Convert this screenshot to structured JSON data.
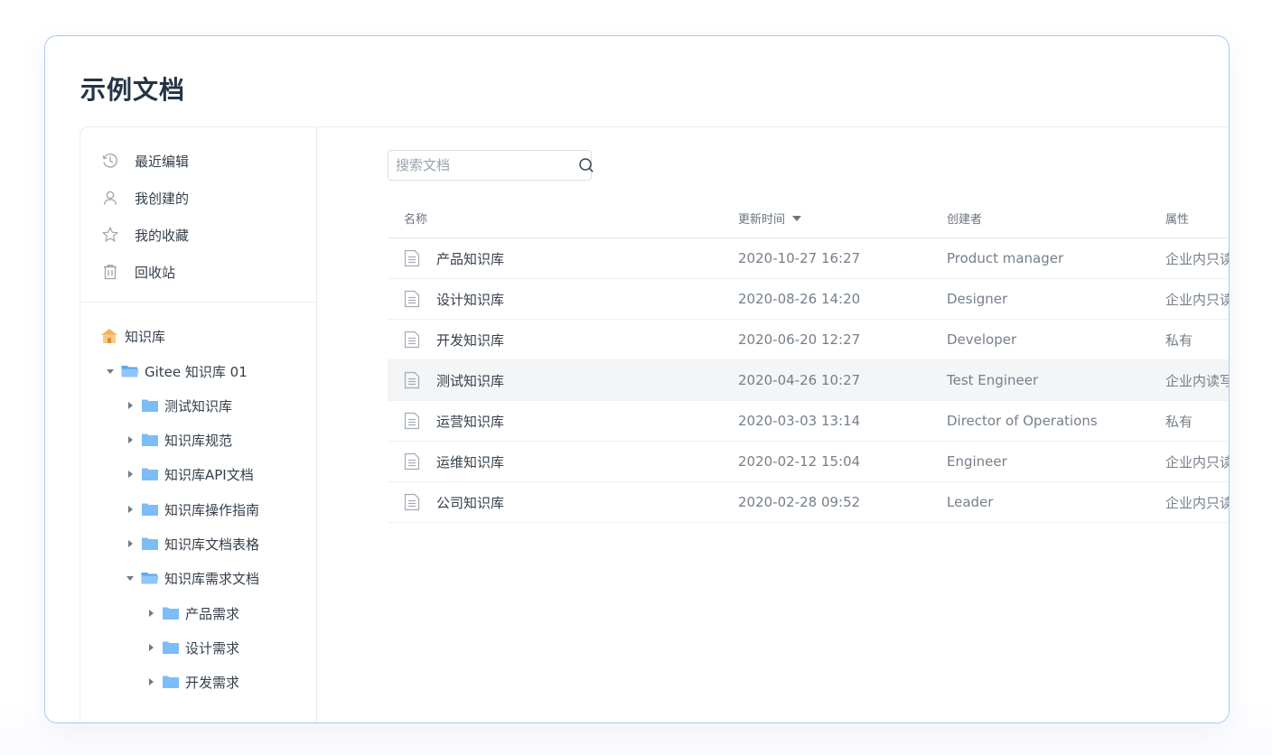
{
  "page": {
    "title": "示例文档"
  },
  "sidebar": {
    "nav": [
      {
        "label": "最近编辑",
        "icon": "history-icon"
      },
      {
        "label": "我创建的",
        "icon": "user-icon"
      },
      {
        "label": "我的收藏",
        "icon": "star-icon"
      },
      {
        "label": "回收站",
        "icon": "trash-icon"
      }
    ],
    "tree": {
      "root_label": "知识库",
      "root_icon": "house-icon",
      "space_label": "Gitee 知识库 01",
      "children": [
        "测试知识库",
        "知识库规范",
        "知识库API文档",
        "知识库操作指南",
        "知识库文档表格"
      ],
      "open_child": "知识库需求文档",
      "grandchildren": [
        "产品需求",
        "设计需求",
        "开发需求"
      ]
    }
  },
  "search": {
    "placeholder": "搜索文档",
    "value": ""
  },
  "table": {
    "headers": {
      "name": "名称",
      "updated": "更新时间",
      "creator": "创建者",
      "attribute": "属性"
    },
    "rows": [
      {
        "name": "产品知识库",
        "updated": "2020-10-27 16:27",
        "creator": "Product manager",
        "attribute": "企业内只读"
      },
      {
        "name": "设计知识库",
        "updated": "2020-08-26 14:20",
        "creator": "Designer",
        "attribute": "企业内只读"
      },
      {
        "name": "开发知识库",
        "updated": "2020-06-20 12:27",
        "creator": "Developer",
        "attribute": "私有"
      },
      {
        "name": "测试知识库",
        "updated": "2020-04-26 10:27",
        "creator": "Test Engineer",
        "attribute": "企业内读写"
      },
      {
        "name": "运营知识库",
        "updated": "2020-03-03 13:14",
        "creator": "Director of Operations",
        "attribute": "私有"
      },
      {
        "name": "运维知识库",
        "updated": "2020-02-12 15:04",
        "creator": "Engineer",
        "attribute": "企业内只读"
      },
      {
        "name": "公司知识库",
        "updated": "2020-02-28 09:52",
        "creator": "Leader",
        "attribute": "企业内只读"
      }
    ]
  },
  "colors": {
    "accent_border": "#a9c9f7",
    "folder": "#7cbcf7",
    "row_hover": "#f3f5f7"
  }
}
